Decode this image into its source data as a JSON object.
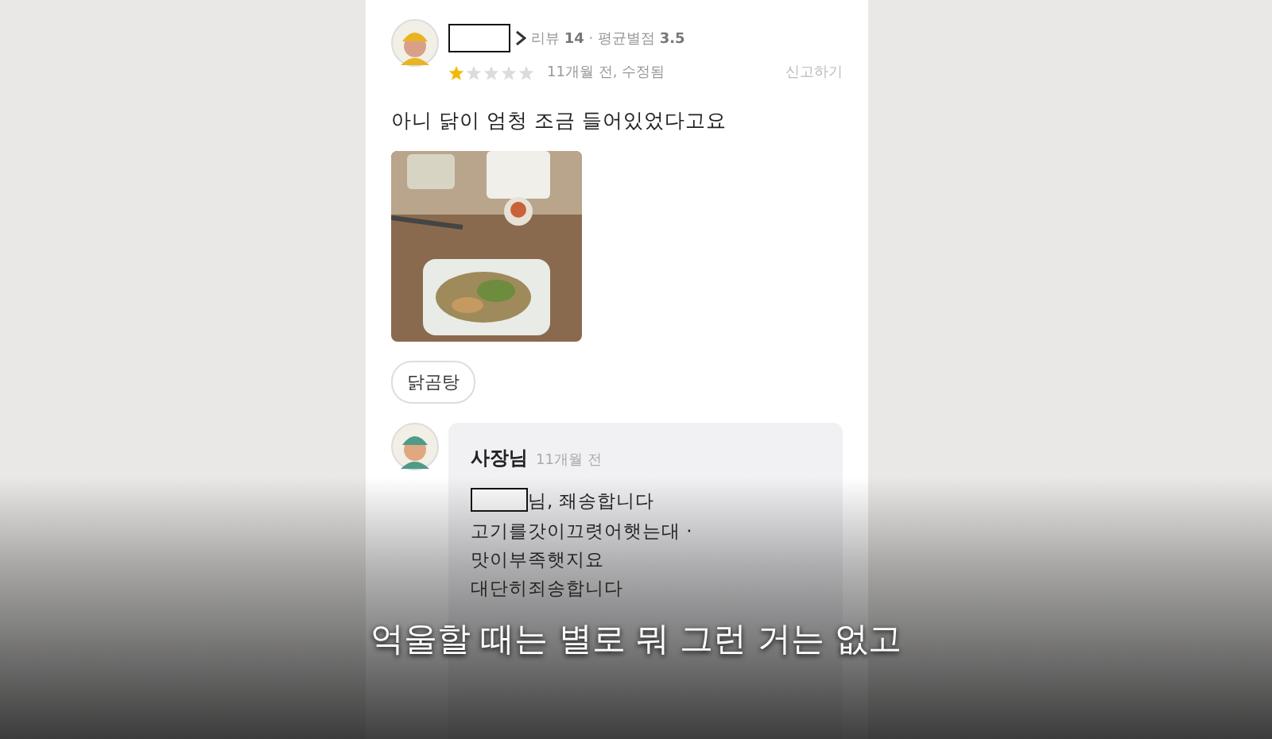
{
  "review": {
    "name_redacted": true,
    "stats": "리뷰 **14** · 평균별점 **3.5**",
    "stars": 1,
    "time": "11개월 전, 수정됨",
    "report": "신고하기",
    "text": "아니 닭이 엄청 조금 들어있었다고요",
    "tags": [
      "닭곰탕"
    ]
  },
  "reply": {
    "author": "사장님",
    "time": "11개월 전",
    "lines": [
      {
        "redacted_prefix": true,
        "text": "님, 좨송합니다"
      },
      {
        "redacted_prefix": false,
        "text": "고기를갓이끄렷어햇는대 ·"
      },
      {
        "redacted_prefix": false,
        "text": "맛이부족햇지요"
      },
      {
        "redacted_prefix": false,
        "text": "대단히죄송합니다"
      }
    ]
  },
  "subtitle": "억울할 때는 별로 뭐 그런 거는 없고"
}
